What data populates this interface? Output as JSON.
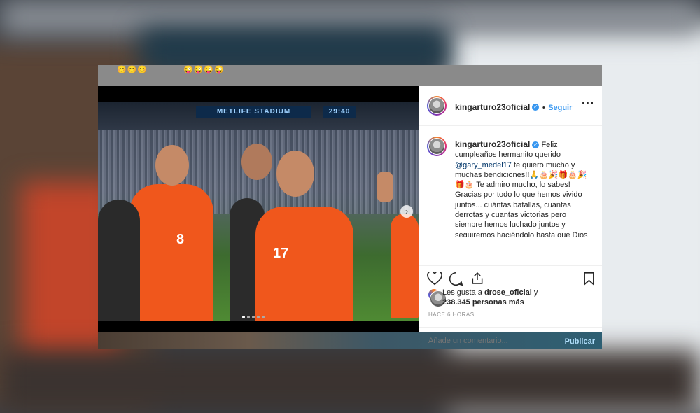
{
  "top_emojis": {
    "left": "😊😊😊",
    "right": "😜😜😜😜"
  },
  "photo": {
    "screen_1": "METLIFE STADIUM",
    "screen_2": "29:40",
    "jersey_left": "8",
    "jersey_right": "17"
  },
  "post": {
    "username": "kingarturo23oficial",
    "separator": "•",
    "follow_label": "Seguir",
    "more_icon": "more-horizontal-icon",
    "caption": {
      "user": "kingarturo23oficial",
      "text_1": "Feliz cumpleaños hermanito querido",
      "mention": "@gary_medel17",
      "text_2": "te quiero mucho y muchas bendiciones!!🙏🎂🎉🎁🎂🎉🎁🎂 Te admiro mucho, lo sabes! Gracias por todo lo que hemos vivido juntos... cuántas batallas, cuántas derrotas y cuantas victorias pero siempre hemos luchado juntos y seguiremos haciéndolo hasta que Dios"
    },
    "likes": {
      "prefix": "Les gusta a",
      "liker": "drose_oficial",
      "and": "y",
      "count": "238.345 personas más"
    },
    "timestamp": "HACE 6 HORAS",
    "comment_placeholder": "Añade un comentario...",
    "publish_label": "Publicar"
  },
  "colors": {
    "link": "#3897f0",
    "text": "#262626",
    "muted": "#8e8e8e",
    "jersey": "#f0571c"
  }
}
